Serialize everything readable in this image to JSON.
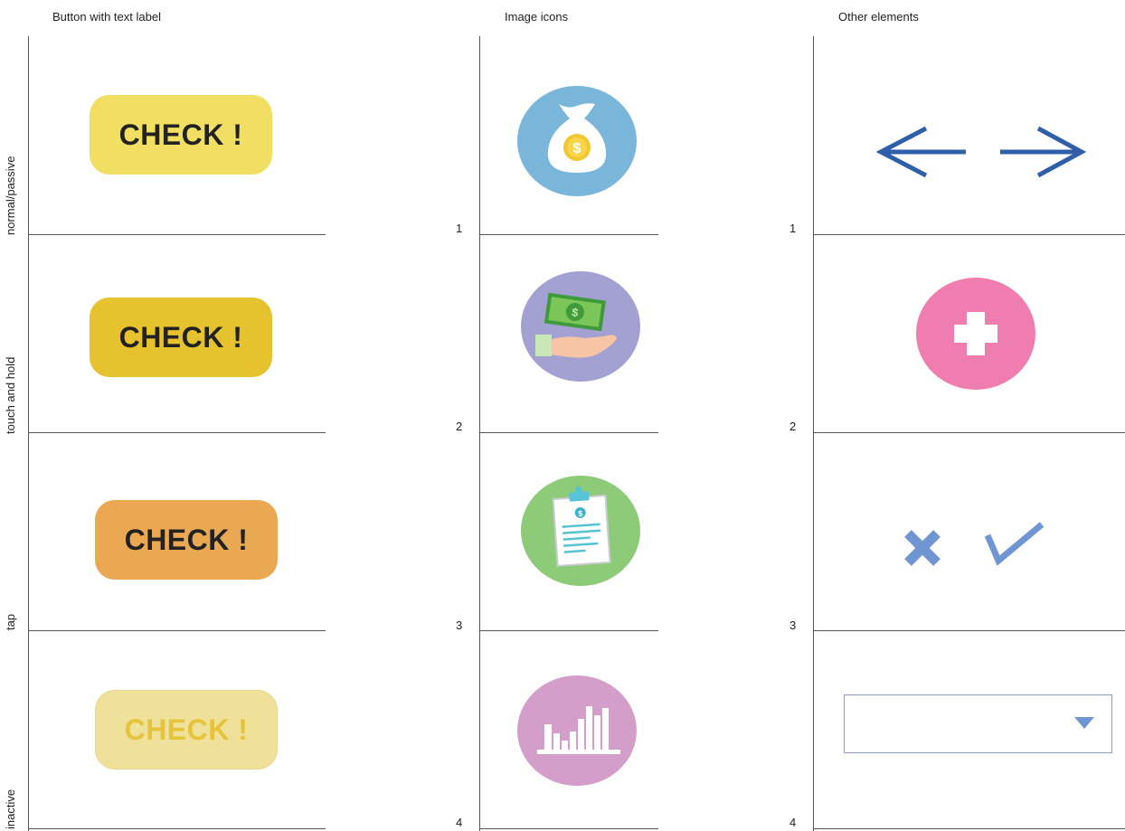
{
  "headers": {
    "buttons": "Button with text label",
    "image_icons": "Image icons",
    "other_elements": "Other elements"
  },
  "row_labels": [
    "normal/passive",
    "touch and hold",
    "tap",
    "inactive"
  ],
  "buttons": {
    "label": "CHECK !",
    "states": [
      "normal",
      "touch-and-hold",
      "tap",
      "inactive"
    ]
  },
  "image_icons": {
    "numbers": [
      "1",
      "2",
      "3",
      "4"
    ],
    "icons": [
      {
        "name": "money-bag-icon",
        "bg": "#79b6d9"
      },
      {
        "name": "cash-hand-icon",
        "bg": "#a3a1d2"
      },
      {
        "name": "clipboard-icon",
        "bg": "#8ecb79"
      },
      {
        "name": "bar-chart-icon",
        "bg": "#d49ecb"
      }
    ]
  },
  "other_elements": {
    "numbers": [
      "1",
      "2",
      "3",
      "4"
    ],
    "items": [
      "arrow-left-icon",
      "arrow-right-icon",
      "plus-icon",
      "cross-icon",
      "check-icon",
      "dropdown"
    ]
  },
  "colors": {
    "btn_normal": "#f1df63",
    "btn_touch": "#e6c22f",
    "btn_tap": "#eba853",
    "btn_inactive": "#efe09a",
    "arrow_blue": "#2e5fa8",
    "plus_pink": "#f07daf",
    "soft_blue": "#6f96d2"
  }
}
